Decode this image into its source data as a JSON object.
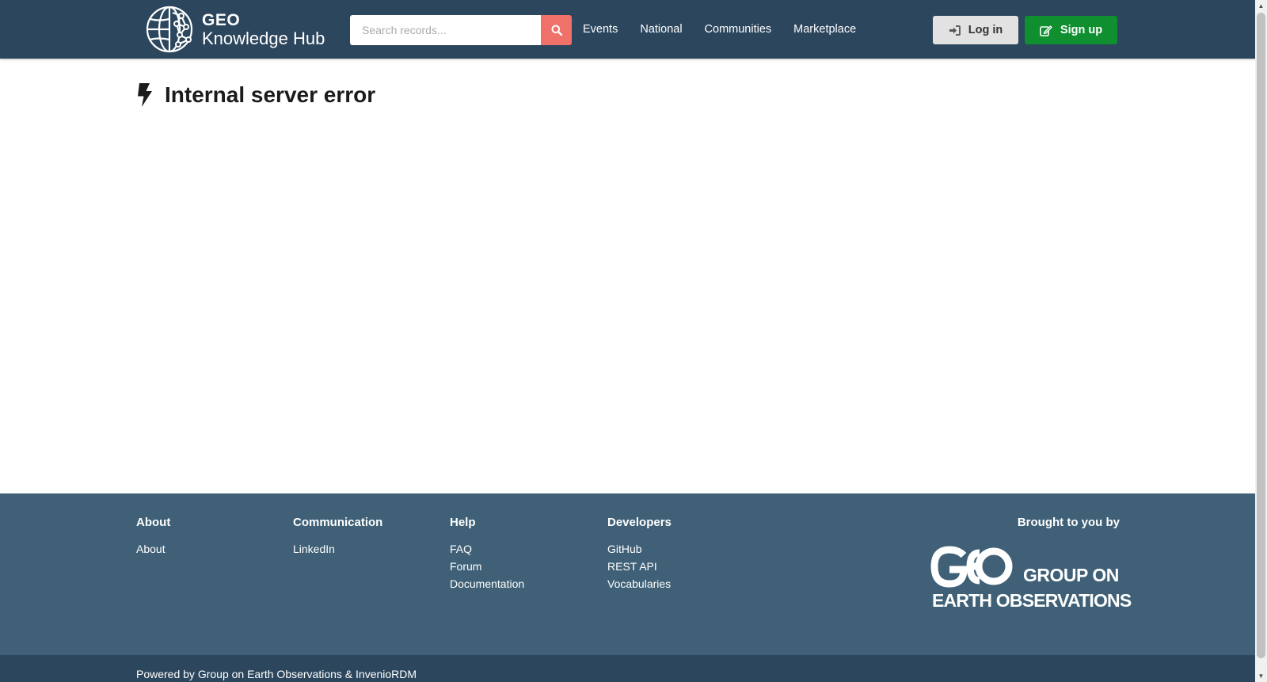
{
  "header": {
    "logo_line1": "GEO",
    "logo_line2": "Knowledge Hub",
    "search_placeholder": "Search records...",
    "nav": [
      "Events",
      "National",
      "Communities",
      "Marketplace"
    ],
    "login_label": "Log in",
    "signup_label": "Sign up"
  },
  "main": {
    "title": "Internal server error"
  },
  "footer": {
    "columns": [
      {
        "heading": "About",
        "links": [
          "About"
        ]
      },
      {
        "heading": "Communication",
        "links": [
          "LinkedIn"
        ]
      },
      {
        "heading": "Help",
        "links": [
          "FAQ",
          "Forum",
          "Documentation"
        ]
      },
      {
        "heading": "Developers",
        "links": [
          "GitHub",
          "REST API",
          "Vocabularies"
        ]
      }
    ],
    "brought_by": "Brought to you by",
    "geo_org_line1": "GROUP ON",
    "geo_org_line2": "EARTH OBSERVATIONS",
    "powered_by": "Powered by Group on Earth Observations & InvenioRDM"
  },
  "colors": {
    "header_bg": "#2c465d",
    "footer_bg": "#3f6077",
    "search_button": "#f0716a",
    "signup_button": "#0f8f2f",
    "login_button": "#e2e2e2"
  },
  "icons": {
    "logo": "globe-brain-icon",
    "search": "search-icon",
    "login": "sign-in-icon",
    "signup": "edit-icon",
    "title": "bolt-icon"
  }
}
